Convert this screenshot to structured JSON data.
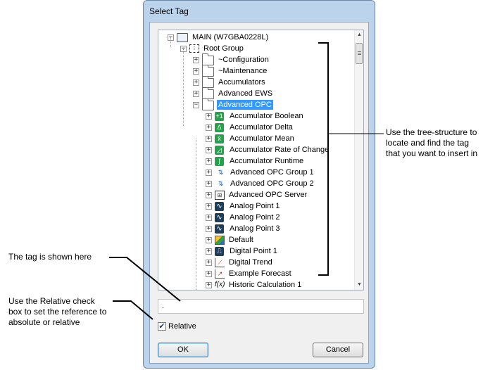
{
  "dialog": {
    "title": "Select Tag",
    "tree": {
      "items": [
        {
          "label": "MAIN (W7GBA0228L)",
          "icon": "computer-icon",
          "expander": "−"
        },
        {
          "label": "Root Group",
          "icon": "group-icon",
          "expander": "−"
        },
        {
          "label": "~Configuration",
          "icon": "folder-icon",
          "expander": "+"
        },
        {
          "label": "~Maintenance",
          "icon": "folder-icon",
          "expander": "+"
        },
        {
          "label": "Accumulators",
          "icon": "folder-icon",
          "expander": "+"
        },
        {
          "label": "Advanced EWS",
          "icon": "folder-icon",
          "expander": "+"
        },
        {
          "label": "Advanced OPC",
          "icon": "folder-icon",
          "expander": "−"
        },
        {
          "label": "Accumulator Boolean",
          "icon": "accumulator-boolean-icon",
          "expander": "+",
          "glyph": "+1"
        },
        {
          "label": "Accumulator Delta",
          "icon": "accumulator-delta-icon",
          "expander": "+",
          "glyph": "Δ"
        },
        {
          "label": "Accumulator Mean",
          "icon": "accumulator-mean-icon",
          "expander": "+",
          "glyph": "x̄"
        },
        {
          "label": "Accumulator Rate of Change",
          "icon": "accumulator-rate-icon",
          "expander": "+",
          "glyph": "◿"
        },
        {
          "label": "Accumulator Runtime",
          "icon": "accumulator-runtime-icon",
          "expander": "+",
          "glyph": "ʃ"
        },
        {
          "label": "Advanced OPC Group 1",
          "icon": "opc-group-icon",
          "expander": "+",
          "glyph": "⇅"
        },
        {
          "label": "Advanced OPC Group 2",
          "icon": "opc-group-icon",
          "expander": "+",
          "glyph": "⇅"
        },
        {
          "label": "Advanced OPC Server",
          "icon": "opc-server-icon",
          "expander": "+",
          "glyph": "⊞"
        },
        {
          "label": "Analog Point 1",
          "icon": "analog-point-icon",
          "expander": "+",
          "glyph": "∿"
        },
        {
          "label": "Analog Point 2",
          "icon": "analog-point-icon",
          "expander": "+",
          "glyph": "∿"
        },
        {
          "label": "Analog Point 3",
          "icon": "analog-point-icon",
          "expander": "+",
          "glyph": "∿"
        },
        {
          "label": "Default",
          "icon": "default-icon",
          "expander": "+"
        },
        {
          "label": "Digital Point 1",
          "icon": "digital-point-icon",
          "expander": "+",
          "glyph": "⎍"
        },
        {
          "label": "Digital Trend",
          "icon": "digital-trend-icon",
          "expander": "+",
          "glyph": "⟋"
        },
        {
          "label": "Example Forecast",
          "icon": "forecast-icon",
          "expander": "+",
          "glyph": "↗"
        },
        {
          "label": "Historic Calculation 1",
          "icon": "calculation-icon",
          "expander": "+",
          "glyph": "f(x)"
        }
      ]
    },
    "tag_value": ".",
    "relative_label": "Relative",
    "relative_checked": true,
    "ok_label": "OK",
    "cancel_label": "Cancel"
  },
  "annotations": {
    "tree_note": [
      "Use the tree-structure to",
      "locate and find the tag",
      "that you want to insert in"
    ],
    "tag_note": "The tag is shown here",
    "relative_note": [
      "Use the Relative check",
      "box to set the reference to",
      "absolute or relative"
    ]
  }
}
